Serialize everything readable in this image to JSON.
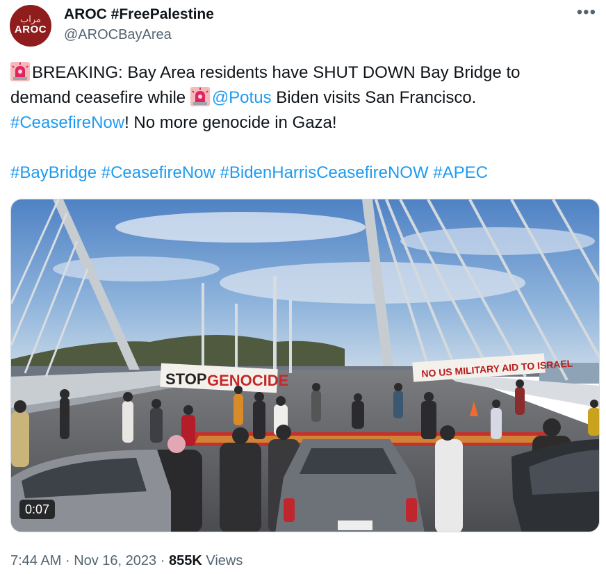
{
  "author": {
    "avatar_glyph": "مراب",
    "avatar_abbr": "AROC",
    "name": "AROC #FreePalestine",
    "handle": "@AROCBayArea"
  },
  "menu_icon": "more-horizontal-icon",
  "tweet": {
    "line1_text": "BREAKING: Bay Area residents have SHUT DOWN Bay Bridge to",
    "line2_text_a": "demand ceasefire while ",
    "line2_mention": "@Potus",
    "line2_text_b": " Biden visits San Francisco.",
    "line3_hashtag": "#CeasefireNow",
    "line3_text": "! No more genocide in Gaza!",
    "hashtags": [
      "#BayBridge",
      "#CeasefireNow",
      "#BidenHarrisCeasefireNOW",
      "#APEC"
    ],
    "emoji_icon": "police-light-icon"
  },
  "media": {
    "banner_left": "STOP",
    "banner_left_2": "GENOCIDE",
    "banner_right": "NO US MILITARY AID TO ISRAEL",
    "duration": "0:07"
  },
  "meta": {
    "time": "7:44 AM",
    "date": "Nov 16, 2023",
    "views_count": "855K",
    "views_label": "Views",
    "separator": "·"
  },
  "colors": {
    "link": "#1d9bf0",
    "secondary": "#536471",
    "avatar_bg": "#8f1d1d"
  }
}
